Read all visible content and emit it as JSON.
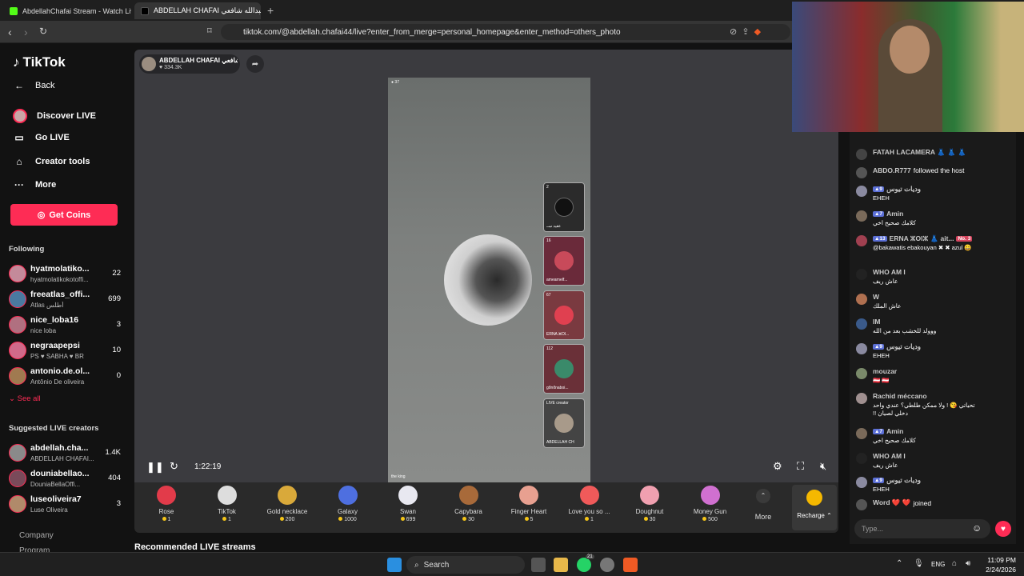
{
  "browser": {
    "tabs": [
      {
        "title": "AbdellahChafai Stream - Watch Live o",
        "active": false
      },
      {
        "title": "ABDELLAH CHAFAI عبدالله شافعي",
        "active": true
      }
    ],
    "url": "tiktok.com/@abdellah.chafai44/live?enter_from_merge=personal_homepage&enter_method=others_photo"
  },
  "sidebar": {
    "logo": "TikTok",
    "back": "Back",
    "nav": [
      {
        "label": "Discover LIVE",
        "icon": "discover-live-icon"
      },
      {
        "label": "Go LIVE",
        "icon": "camera-icon"
      },
      {
        "label": "Creator tools",
        "icon": "home-icon"
      },
      {
        "label": "More",
        "icon": "more-dots-icon"
      }
    ],
    "get_coins": "Get Coins",
    "following_title": "Following",
    "following": [
      {
        "name": "hyatmolatiko...",
        "sub": "hyatmolatikokotoffi...",
        "count": "22"
      },
      {
        "name": "freeatlas_offi...",
        "sub": "Atlas أطلس",
        "count": "699"
      },
      {
        "name": "nice_loba16",
        "sub": "nice loba",
        "count": "3"
      },
      {
        "name": "negraapepsi",
        "sub": "PS ♥ SABHA ♥ BR",
        "count": "10"
      },
      {
        "name": "antonio.de.ol...",
        "sub": "Antônio De oliveira",
        "count": "0"
      }
    ],
    "see_all": "See all",
    "suggested_title": "Suggested LIVE creators",
    "suggested": [
      {
        "name": "abdellah.cha...",
        "sub": "ABDELLAH CHAFAI...",
        "count": "1.4K"
      },
      {
        "name": "douniabellao...",
        "sub": "DouniaBellaOffi...",
        "count": "404"
      },
      {
        "name": "luseoliveira7",
        "sub": "Luse Oliveira",
        "count": "3"
      }
    ],
    "company": "Company",
    "program": "Program"
  },
  "stream": {
    "host_name": "ABDELLAH CHAFAI عبدالله شافعي",
    "likes": "334.3K",
    "viewer_count": "37",
    "video_tag": "the king",
    "timer": "1:22:19",
    "guests": [
      {
        "count": "2",
        "name": "عقيد ســ"
      },
      {
        "count": "16",
        "name": "amearnelf..."
      },
      {
        "count": "67",
        "name": "ERNA ⵣOl..."
      },
      {
        "count": "112",
        "name": "gőnőnaboi..."
      },
      {
        "count": "LIVE creator",
        "name": "ABDELLAH CH"
      }
    ]
  },
  "gifts": [
    {
      "name": "Rose",
      "price": "1",
      "color": "#e23b4a"
    },
    {
      "name": "TikTok",
      "price": "1",
      "color": "#dddddd"
    },
    {
      "name": "Gold necklace",
      "price": "200",
      "color": "#d9a93a"
    },
    {
      "name": "Galaxy",
      "price": "1000",
      "color": "#4e6fe0"
    },
    {
      "name": "Swan",
      "price": "699",
      "color": "#e8e8f0"
    },
    {
      "name": "Capybara",
      "price": "30",
      "color": "#a86a3a"
    },
    {
      "name": "Finger Heart",
      "price": "5",
      "color": "#e8a090"
    },
    {
      "name": "Love you so ...",
      "price": "1",
      "color": "#f05a5a"
    },
    {
      "name": "Doughnut",
      "price": "30",
      "color": "#f0a0b0"
    },
    {
      "name": "Money Gun",
      "price": "500",
      "color": "#d070d0"
    }
  ],
  "gift_more": "More",
  "recharge": "Recharge",
  "recommended_title": "Recommended LIVE streams",
  "chat": {
    "messages": [
      {
        "header": "FATAH LACAMERA 👗 👗 👗",
        "text": "",
        "level": ""
      },
      {
        "header": "ABDO.R777",
        "text": "followed the host",
        "level": "",
        "inline": true
      },
      {
        "header": "وديات تيوس",
        "text": "EHEH",
        "level": "9"
      },
      {
        "header": "Amin",
        "text": "كلامك صحيح اخي",
        "level": "7"
      },
      {
        "header": "ERNA ⵣOlⵣ 👗 ait...",
        "text": "@bakawatis ebakouyan ✖ ✖ azul 😀",
        "level": "13",
        "badge": "No. 3"
      },
      {
        "header": "WHO AM I",
        "text": "عاش ريف",
        "level": ""
      },
      {
        "header": "W",
        "text": "عاش الملك",
        "level": ""
      },
      {
        "header": "IM",
        "text": "ووولد للخشب بعد من الله",
        "level": ""
      },
      {
        "header": "وديات تيوس",
        "text": "EHEH",
        "level": "9"
      },
      {
        "header": "mouzar",
        "text": "🇦🇹 🇦🇹",
        "level": ""
      },
      {
        "header": "Rachid méccano",
        "text": "تحياتي 😘 ! ولا ممكن طلطي؟ عندي واحد",
        "text2": "!! دخلي لصيان",
        "level": ""
      },
      {
        "header": "Amin",
        "text": "كلامك صحيح اخي",
        "level": "7"
      },
      {
        "header": "WHO AM I",
        "text": "عاش ريف",
        "level": ""
      },
      {
        "header": "وديات تيوس",
        "text": "EHEH",
        "level": "9"
      },
      {
        "header": "Word ❤️ ❤️",
        "text": "joined",
        "level": "",
        "inline": true
      }
    ],
    "input_placeholder": "Type..."
  },
  "taskbar": {
    "search": "Search",
    "lang": "ENG",
    "time": "11:09 PM",
    "date": "2/24/2026",
    "badge": "21"
  }
}
